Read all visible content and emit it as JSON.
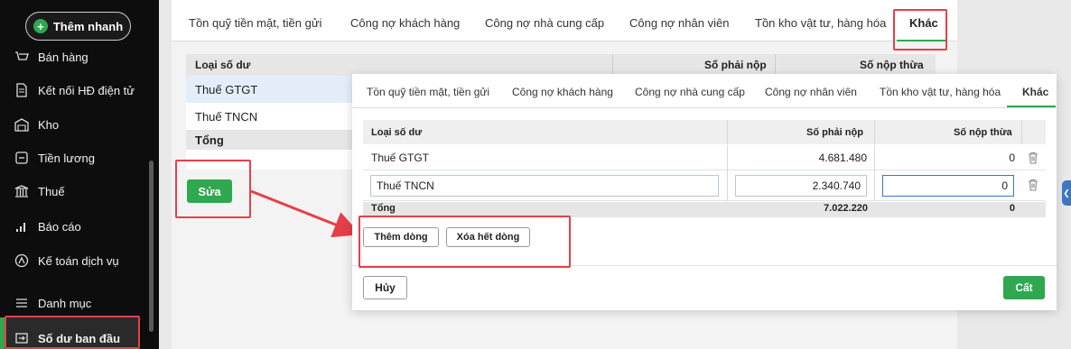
{
  "sidebar": {
    "quick_add_label": "Thêm nhanh",
    "items": [
      {
        "label": "Bán hàng",
        "icon": "cart-icon"
      },
      {
        "label": "Kết nối HĐ điện tử",
        "icon": "document-icon"
      },
      {
        "label": "Kho",
        "icon": "warehouse-icon"
      },
      {
        "label": "Tiền lương",
        "icon": "payroll-icon"
      },
      {
        "label": "Thuế",
        "icon": "tax-building-icon"
      },
      {
        "label": "Báo cáo",
        "icon": "bar-chart-icon"
      },
      {
        "label": "Kế toán dịch vụ",
        "icon": "service-icon"
      },
      {
        "label": "Danh mục",
        "icon": "list-icon"
      },
      {
        "label": "Số dư ban đầu",
        "icon": "opening-balance-icon"
      }
    ]
  },
  "background": {
    "tabs": [
      "Tồn quỹ tiền mặt, tiền gửi",
      "Công nợ khách hàng",
      "Công nợ nhà cung cấp",
      "Công nợ nhân viên",
      "Tồn kho vật tư, hàng hóa",
      "Khác"
    ],
    "table": {
      "headers": [
        "Loại số dư",
        "Số phải nộp",
        "Số nộp thừa"
      ],
      "rows": [
        "Thuế GTGT",
        "Thuế TNCN"
      ],
      "total_label": "Tổng"
    },
    "edit_button": "Sửa"
  },
  "dialog": {
    "tabs": [
      "Tồn quỹ tiền mặt, tiền gửi",
      "Công nợ khách hàng",
      "Công nợ nhà cung cấp",
      "Công nợ nhân viên",
      "Tồn kho vật tư, hàng hóa",
      "Khác"
    ],
    "table": {
      "headers": [
        "Loại số dư",
        "Số phải nộp",
        "Số nộp thừa"
      ],
      "rows": [
        {
          "type": "Thuế GTGT",
          "payable": "4.681.480",
          "overpaid": "0"
        },
        {
          "type": "Thuế TNCN",
          "payable": "2.340.740",
          "overpaid": "0"
        }
      ],
      "total": {
        "label": "Tổng",
        "payable": "7.022.220",
        "overpaid": "0"
      }
    },
    "add_row_button": "Thêm dòng",
    "clear_rows_button": "Xóa hết dòng",
    "cancel_button": "Hủy",
    "save_button": "Cất"
  },
  "colors": {
    "accent": "#2fa84f",
    "highlight": "#e5404a",
    "sidebar_bg": "#0d0d0d",
    "focus": "#3d76c9"
  }
}
